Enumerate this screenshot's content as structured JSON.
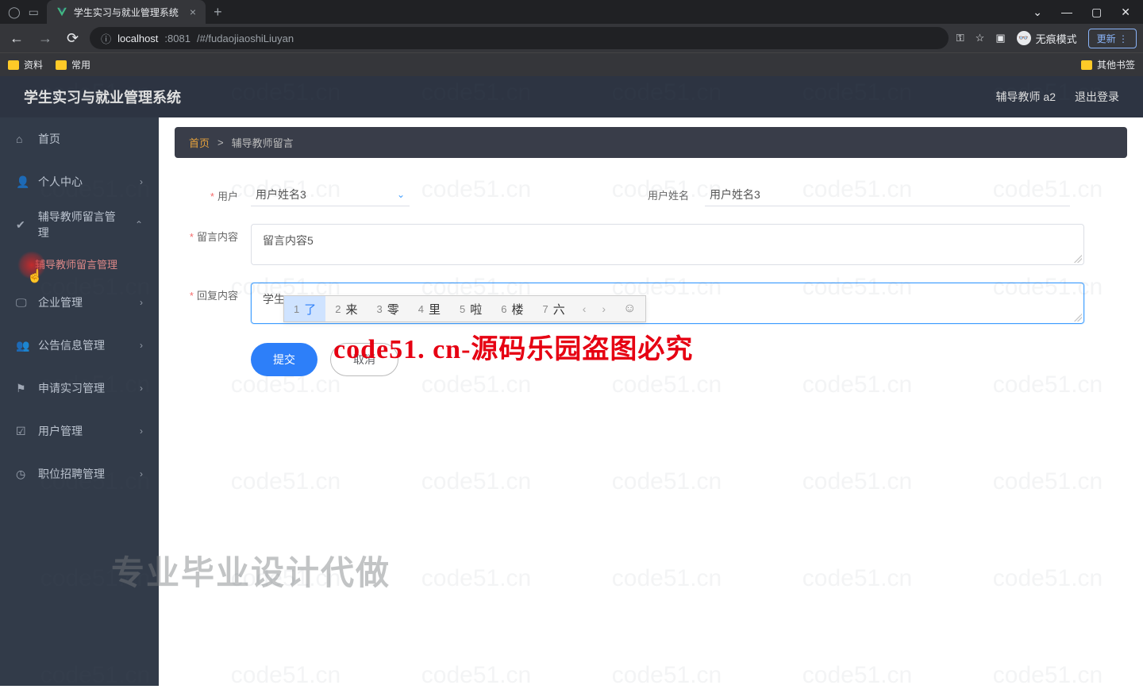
{
  "browser": {
    "tab_title": "学生实习与就业管理系统",
    "url_host": "localhost",
    "url_port": ":8081",
    "url_path": "/#/fudaojiaoshiLiuyan",
    "bookmarks": [
      "资料",
      "常用"
    ],
    "other_bookmarks": "其他书签",
    "incognito_label": "无痕模式",
    "update_label": "更新"
  },
  "header": {
    "title": "学生实习与就业管理系统",
    "user": "辅导教师 a2",
    "logout": "退出登录"
  },
  "sidebar": {
    "items": [
      {
        "icon": "⌂",
        "label": "首页",
        "chev": ""
      },
      {
        "icon": "👤",
        "label": "个人中心",
        "chev": "›"
      },
      {
        "icon": "✔",
        "label": "辅导教师留言管理",
        "chev": "⌃"
      },
      {
        "icon": "",
        "label": "辅导教师留言管理",
        "sub": true
      },
      {
        "icon": "🖵",
        "label": "企业管理",
        "chev": "›"
      },
      {
        "icon": "👥",
        "label": "公告信息管理",
        "chev": "›"
      },
      {
        "icon": "⚑",
        "label": "申请实习管理",
        "chev": "›"
      },
      {
        "icon": "☑",
        "label": "用户管理",
        "chev": "›"
      },
      {
        "icon": "◷",
        "label": "职位招聘管理",
        "chev": "›"
      }
    ]
  },
  "breadcrumb": {
    "home": "首页",
    "sep": ">",
    "current": "辅导教师留言"
  },
  "form": {
    "user_label": "用户",
    "user_value": "用户姓名3",
    "username_label": "用户姓名",
    "username_value": "用户姓名3",
    "message_label": "留言内容",
    "message_value": "留言内容5",
    "reply_label": "回复内容",
    "reply_value": "学生l",
    "submit": "提交",
    "cancel": "取消"
  },
  "ime": {
    "candidates": [
      {
        "n": "1",
        "ch": "了"
      },
      {
        "n": "2",
        "ch": "来"
      },
      {
        "n": "3",
        "ch": "零"
      },
      {
        "n": "4",
        "ch": "里"
      },
      {
        "n": "5",
        "ch": "啦"
      },
      {
        "n": "6",
        "ch": "楼"
      },
      {
        "n": "7",
        "ch": "六"
      }
    ]
  },
  "watermark_text": "code51.cn",
  "overlay_red": "code51. cn-源码乐园盗图必究",
  "footer_text": "专业毕业设计代做"
}
